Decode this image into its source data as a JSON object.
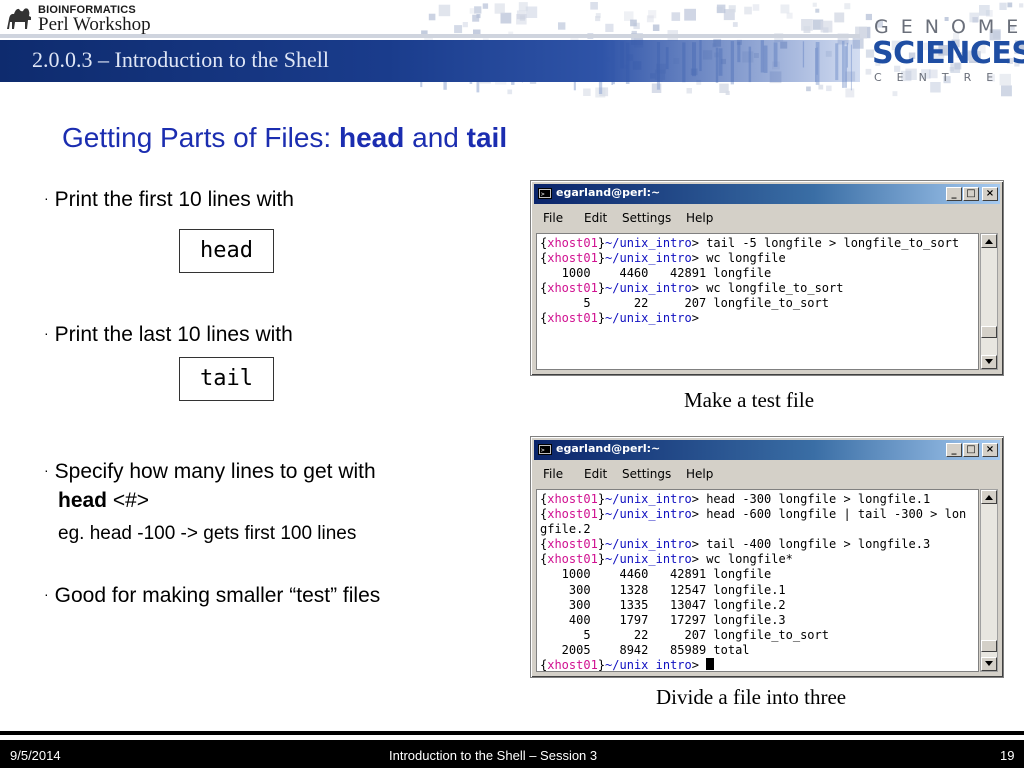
{
  "header": {
    "logo_top": "BIOINFORMATICS",
    "logo_bottom": "Perl Workshop",
    "section_title": "2.0.0.3 – Introduction to the Shell",
    "gsc_line1": "GENOME",
    "gsc_line2": "SCIENCES",
    "gsc_line3": "CENTRE",
    "accent_color": "#1b2db0",
    "bar_color": "#0e2b6e"
  },
  "slide": {
    "title_plain": "Getting Parts of Files: ",
    "title_b1": "head",
    "title_mid": " and ",
    "title_b2": "tail",
    "bullet_mark": "·",
    "bullet1": "Print the first 10 lines with",
    "cmd_head": "head",
    "bullet2": "Print the last 10 lines with",
    "cmd_tail": "tail",
    "bullet3": "Specify how many lines to get with",
    "bullet3_cmd": "head",
    "bullet3_arg": " <#>",
    "bullet3_example": "eg. head -100 -> gets first 100 lines",
    "bullet4": "Good for making smaller “test” files"
  },
  "terminal1": {
    "title": "egarland@perl:~",
    "menu": [
      "File",
      "Edit",
      "Settings",
      "Help"
    ],
    "lines": [
      {
        "host": "xhost01",
        "path": "~/unix_intro",
        "cmd": "> tail -5 longfile > longfile_to_sort"
      },
      {
        "host": "xhost01",
        "path": "~/unix_intro",
        "cmd": "> wc longfile"
      },
      {
        "text": "   1000    4460   42891 longfile"
      },
      {
        "host": "xhost01",
        "path": "~/unix_intro",
        "cmd": "> wc longfile_to_sort"
      },
      {
        "text": "      5      22     207 longfile_to_sort"
      },
      {
        "host": "xhost01",
        "path": "~/unix_intro",
        "cmd": ">"
      }
    ],
    "caption": "Make a test file"
  },
  "terminal2": {
    "title": "egarland@perl:~",
    "menu": [
      "File",
      "Edit",
      "Settings",
      "Help"
    ],
    "lines": [
      {
        "host": "xhost01",
        "path": "~/unix_intro",
        "cmd": "> head -300 longfile > longfile.1"
      },
      {
        "host": "xhost01",
        "path": "~/unix_intro",
        "cmd": "> head -600 longfile | tail -300 > lon"
      },
      {
        "text": "gfile.2"
      },
      {
        "host": "xhost01",
        "path": "~/unix_intro",
        "cmd": "> tail -400 longfile > longfile.3"
      },
      {
        "host": "xhost01",
        "path": "~/unix_intro",
        "cmd": "> wc longfile*"
      },
      {
        "text": "   1000    4460   42891 longfile"
      },
      {
        "text": "    300    1328   12547 longfile.1"
      },
      {
        "text": "    300    1335   13047 longfile.2"
      },
      {
        "text": "    400    1797   17297 longfile.3"
      },
      {
        "text": "      5      22     207 longfile_to_sort"
      },
      {
        "text": "   2005    8942   85989 total"
      },
      {
        "host": "xhost01",
        "path": "~/unix_intro",
        "cmd": "> ",
        "cursor": true
      }
    ],
    "caption": "Divide a file into three"
  },
  "footer": {
    "date": "9/5/2014",
    "title": "Introduction to the Shell – Session 3",
    "page": "19"
  }
}
